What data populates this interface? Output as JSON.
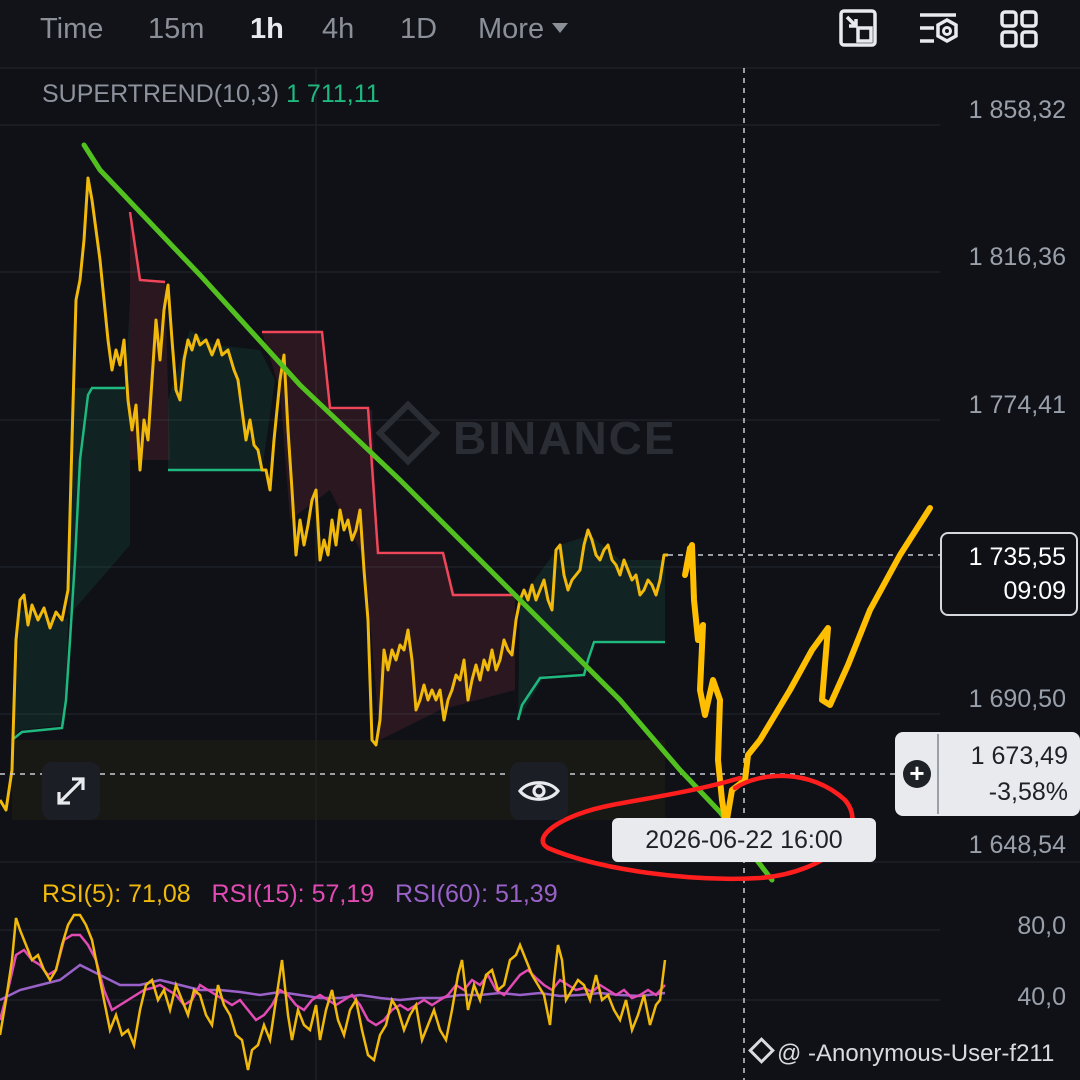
{
  "tabs": [
    {
      "label": "Time"
    },
    {
      "label": "15m"
    },
    {
      "label": "1h"
    },
    {
      "label": "4h"
    },
    {
      "label": "1D"
    },
    {
      "label": "More"
    }
  ],
  "toolbar_icons": [
    "fullscreen-exit-icon",
    "indicator-settings-icon",
    "layout-grid-icon"
  ],
  "indicator": {
    "name": "SUPERTREND(10,3)",
    "value": "1 711,11"
  },
  "price_axis": [
    "1 858,32",
    "1 816,36",
    "1 774,41",
    "1 690,50",
    "1 648,54"
  ],
  "current_price": {
    "price": "1 735,55",
    "countdown": "09:09"
  },
  "crosshair": {
    "price": "1 673,49",
    "change": "-3,58%",
    "date": "2026-06-22 16:00"
  },
  "rsi": {
    "rsi5": {
      "label": "RSI(5):",
      "value": "71,08",
      "color": "#f0b90b"
    },
    "rsi15": {
      "label": "RSI(15):",
      "value": "57,19",
      "color": "#e24bb3"
    },
    "rsi60": {
      "label": "RSI(60):",
      "value": "51,39",
      "color": "#9a62c9"
    },
    "axis": [
      "80,0",
      "40,0"
    ]
  },
  "watermark": "BINANCE",
  "credit": "@ -Anonymous-User-f211",
  "colors": {
    "price_line": "#f0b90b",
    "up": "#1fb87e",
    "down": "#f0465a",
    "trendline": "#52c11f",
    "annotation": "#ff1e1e"
  }
}
